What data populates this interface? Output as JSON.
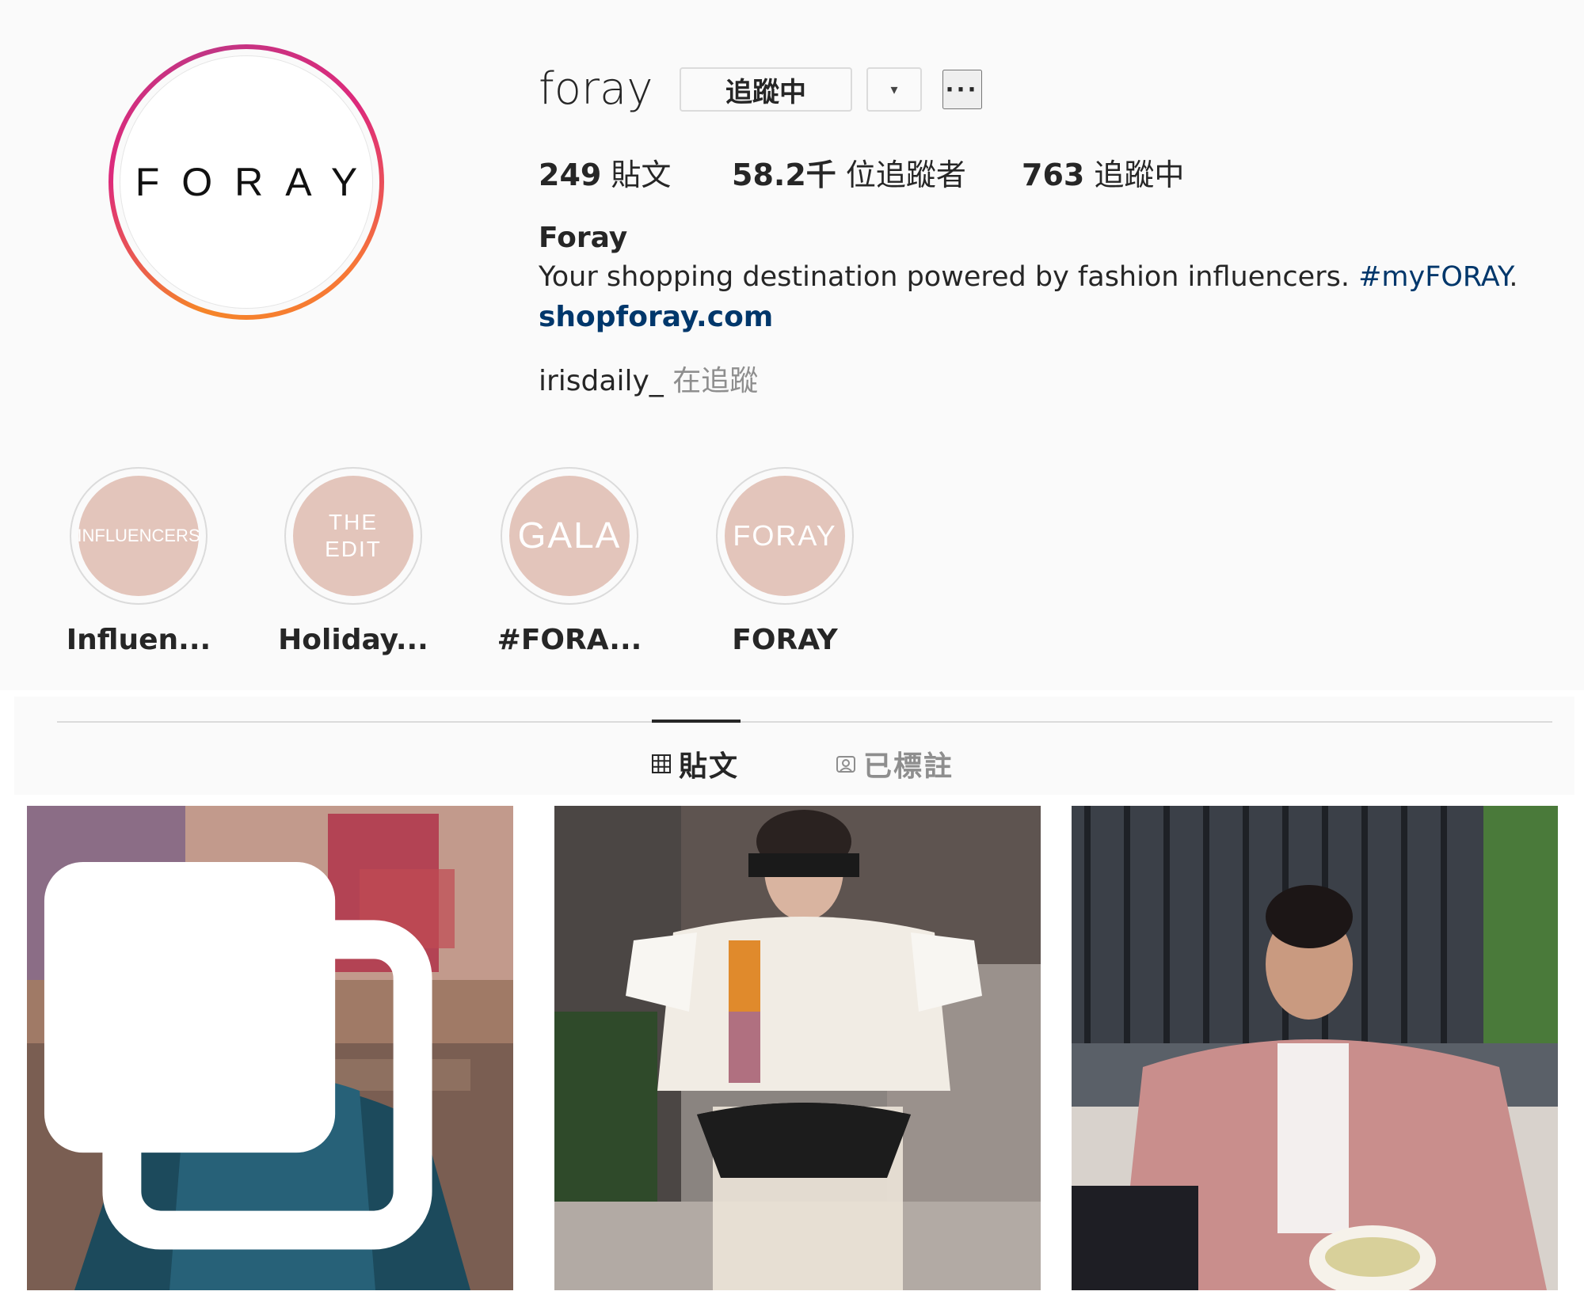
{
  "profile": {
    "avatar_text": "FORAY",
    "username": "foray",
    "follow_button_label": "追蹤中",
    "dropdown_label": "▾",
    "more_label": "···",
    "stats": {
      "posts_count": "249",
      "posts_label": " 貼文",
      "followers_count": "58.2千",
      "followers_label": " 位追蹤者",
      "following_count": "763",
      "following_label": " 追蹤中"
    },
    "bio": {
      "name": "Foray",
      "text": "Your shopping destination powered by fashion influencers. ",
      "hashtag": "#myFORAY",
      "text_end": ".",
      "link": "shopforay.com"
    },
    "followed_by": {
      "user": "irisdaily_",
      "label": " 在追蹤"
    }
  },
  "highlights": [
    {
      "cover_text": "INFLUENCERS",
      "label": "Influen..."
    },
    {
      "cover_text": "THE EDIT",
      "label": "Holiday..."
    },
    {
      "cover_text": "GALA",
      "label": "#FORA..."
    },
    {
      "cover_text": "FORAY",
      "label": "FORAY"
    }
  ],
  "tabs": [
    {
      "label": "貼文",
      "icon": "grid-icon",
      "active": true
    },
    {
      "label": "已標註",
      "icon": "tagged-icon",
      "active": false
    }
  ],
  "posts": [
    {
      "description": "woman in teal satin blouse",
      "multi": true
    },
    {
      "description": "woman in white feather sweater with saddle bag",
      "multi": false
    },
    {
      "description": "woman in pink teddy jacket at cafe",
      "multi": false
    }
  ],
  "colors": {
    "background": "#fafafa",
    "text": "#262626",
    "link": "#00376b",
    "muted": "#8e8e8e",
    "highlight_cover": "#e3c5bb",
    "border": "#dbdbdb"
  }
}
